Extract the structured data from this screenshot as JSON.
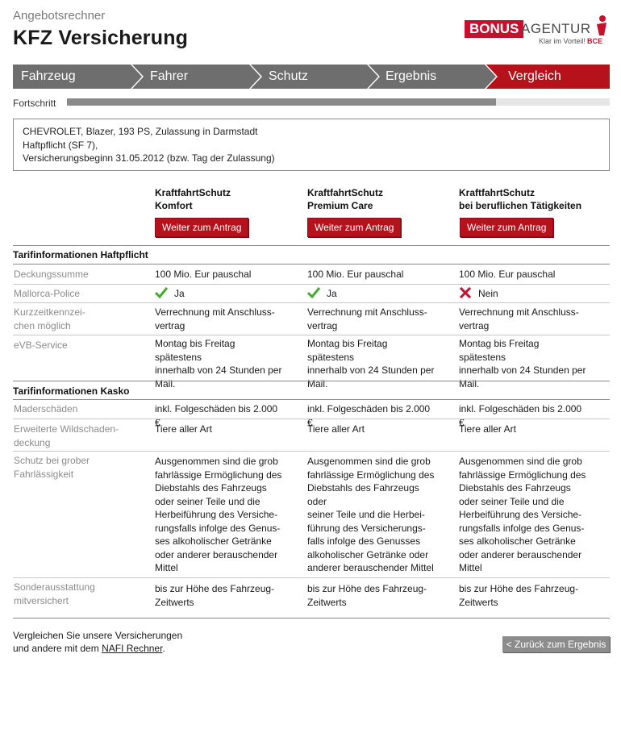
{
  "header": {
    "eyebrow": "Angebotsrechner",
    "title": "KFZ Versicherung"
  },
  "logo": {
    "bonus": "BONUS",
    "agentur": "AGENTUR",
    "tagline": "Klar im Vorteil!",
    "bce": "BCE"
  },
  "steps": [
    {
      "label": "Fahrzeug",
      "active": false
    },
    {
      "label": "Fahrer",
      "active": false
    },
    {
      "label": "Schutz",
      "active": false
    },
    {
      "label": "Ergebnis",
      "active": false
    },
    {
      "label": "Vergleich",
      "active": true
    }
  ],
  "colors": {
    "step_inactive": "#6e6e6e",
    "step_active": "#b5121b",
    "accent_red": "#b5121b",
    "check_green": "#3fae2a",
    "cross_red": "#c8102e"
  },
  "progress": {
    "label": "Fortschritt",
    "fraction": 0.79
  },
  "summary": {
    "line1": "CHEVROLET, Blazer, 193 PS, Zulassung in Darmstadt",
    "line2": "Haftpflicht (SF 7),",
    "line3": "Versicherungsbeginn 31.05.2012 (bzw. Tag der Zulassung)"
  },
  "offers": [
    {
      "name1": "KraftfahrtSchutz",
      "name2": "Komfort",
      "button": "Weiter zum Antrag"
    },
    {
      "name1": "KraftfahrtSchutz",
      "name2": "Premium Care",
      "button": "Weiter zum Antrag"
    },
    {
      "name1": "KraftfahrtSchutz",
      "name2": "bei beruflichen Tätigkeiten",
      "button": "Weiter zum Antrag"
    }
  ],
  "sections": {
    "haftpflicht": "Tarifinformationen Haftpflicht",
    "kasko": "Tarifinformationen Kasko"
  },
  "rows": {
    "deckungssumme": {
      "label": "Deckungssumme",
      "values": [
        "100 Mio. Eur pauschal",
        "100 Mio. Eur pauschal",
        "100 Mio. Eur pauschal"
      ]
    },
    "mallorca": {
      "label": "Mallorca-Police",
      "values": [
        "Ja",
        "Ja",
        "Nein"
      ],
      "icons": [
        "check-icon",
        "check-icon",
        "cross-icon"
      ]
    },
    "kurzzeit": {
      "label1": "Kurzzeitkennzei-",
      "label2": "chen möglich",
      "v1": [
        "Verrechnung mit Anschluss-",
        "Verrechnung mit Anschluss-",
        "Verrechnung mit Anschluss-"
      ],
      "v2": [
        "vertrag",
        "vertrag",
        "vertrag"
      ]
    },
    "evb": {
      "label": "eVB-Service",
      "c0": [
        "Montag bis Freitag spätestens",
        "innerhalb von 24 Stunden per",
        "Mail."
      ],
      "c1": [
        "Montag bis Freitag spätestens",
        "innerhalb von 24 Stunden per",
        "Mail."
      ],
      "c2": [
        "Montag bis Freitag spätestens",
        "innerhalb von 24 Stunden per",
        "Mail."
      ]
    },
    "maderschaeden": {
      "label": "Maderschäden",
      "values": [
        "inkl. Folgeschäden bis 2.000 €",
        "inkl. Folgeschäden bis 2.000 €",
        "inkl. Folgeschäden bis 2.000 €"
      ]
    },
    "wildschaden": {
      "label1": "Erweiterte Wildschaden-",
      "label2": "deckung",
      "values": [
        "Tiere aller Art",
        "Tiere aller Art",
        "Tiere aller Art"
      ]
    },
    "grob": {
      "label1": "Schutz bei grober",
      "label2": "Fahrlässigkeit",
      "c0": [
        "Ausgenommen sind die grob",
        "fahrlässige Ermöglichung des",
        "Diebstahls des Fahrzeugs",
        "oder seiner Teile und die",
        "Herbeiführung des Versiche-",
        "rungsfalls infolge des Genus-",
        "ses alkoholischer Getränke",
        "oder anderer berauschender",
        "Mittel"
      ],
      "c1": [
        "Ausgenommen sind die grob",
        "fahrlässige Ermöglichung des",
        "Diebstahls des Fahrzeugs oder",
        "seiner Teile und die Herbei-",
        "führung des Versicherungs-",
        "falls infolge des Genusses",
        "alkoholischer Getränke oder",
        "anderer berauschender Mittel"
      ],
      "c2": [
        "Ausgenommen sind die grob",
        "fahrlässige Ermöglichung des",
        "Diebstahls des Fahrzeugs",
        "oder seiner Teile und die",
        "Herbeiführung des Versiche-",
        "rungsfalls infolge des Genus-",
        "ses alkoholischer Getränke",
        "oder anderer berauschender",
        "Mittel"
      ]
    },
    "sonder": {
      "label1": "Sonderausstattung",
      "label2": "mitversichert",
      "v1": [
        "bis zur Höhe des Fahrzeug-",
        "bis zur Höhe des Fahrzeug-",
        "bis zur Höhe des Fahrzeug-"
      ],
      "v2": [
        "Zeitwerts",
        "Zeitwerts",
        "Zeitwerts"
      ]
    }
  },
  "footer": {
    "text1": "Vergleichen Sie unsere Versicherungen",
    "text2_prefix": "und andere mit dem ",
    "link": "NAFI Rechner",
    "text2_suffix": ".",
    "back_button": "< Zurück zum Ergebnis"
  }
}
